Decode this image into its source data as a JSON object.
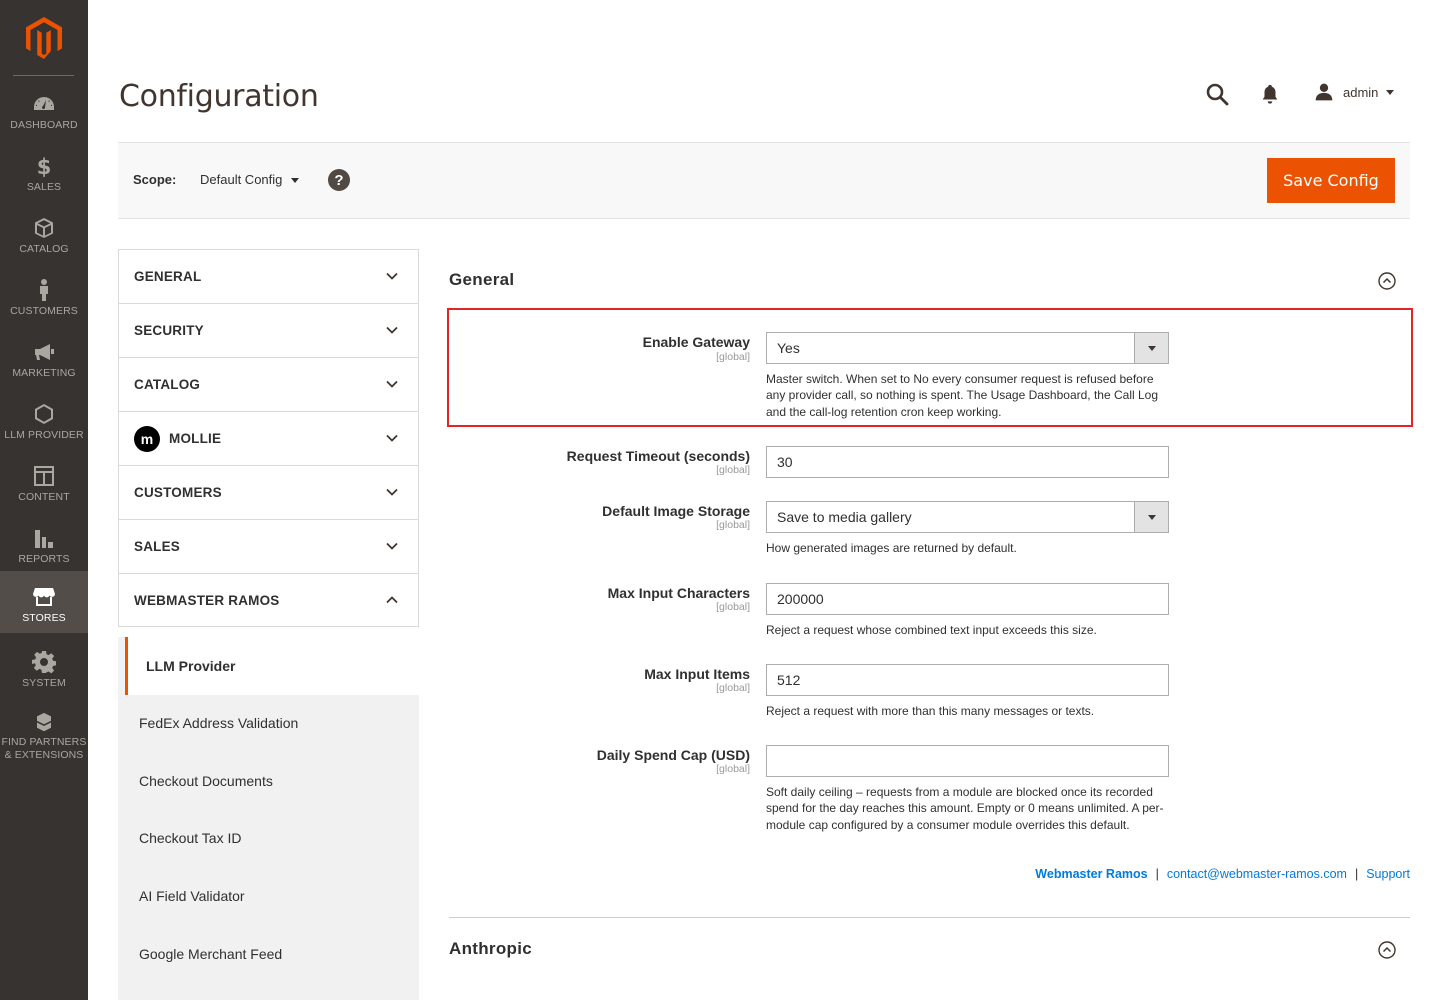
{
  "nav": {
    "items": [
      {
        "label": "DASHBOARD",
        "icon": "dashboard-icon"
      },
      {
        "label": "SALES",
        "icon": "dollar-icon"
      },
      {
        "label": "CATALOG",
        "icon": "box-icon"
      },
      {
        "label": "CUSTOMERS",
        "icon": "person-icon"
      },
      {
        "label": "MARKETING",
        "icon": "megaphone-icon"
      },
      {
        "label": "LLM PROVIDER",
        "icon": "hexagon-icon"
      },
      {
        "label": "CONTENT",
        "icon": "layout-icon"
      },
      {
        "label": "REPORTS",
        "icon": "bar-chart-icon"
      },
      {
        "label": "STORES",
        "icon": "store-icon"
      },
      {
        "label": "SYSTEM",
        "icon": "gear-icon"
      },
      {
        "label": "FIND PARTNERS & EXTENSIONS",
        "icon": "extensions-icon"
      }
    ],
    "active": "STORES"
  },
  "header": {
    "title": "Configuration",
    "user": "admin"
  },
  "scope": {
    "label": "Scope:",
    "value": "Default Config",
    "help": "?",
    "save_label": "Save Config"
  },
  "tabs": [
    {
      "label": "GENERAL"
    },
    {
      "label": "SECURITY"
    },
    {
      "label": "CATALOG"
    },
    {
      "label": "MOLLIE",
      "logo": "m"
    },
    {
      "label": "CUSTOMERS"
    },
    {
      "label": "SALES"
    },
    {
      "label": "WEBMASTER RAMOS"
    }
  ],
  "subtabs": [
    {
      "label": "LLM Provider",
      "active": true
    },
    {
      "label": "FedEx Address Validation"
    },
    {
      "label": "Checkout Documents"
    },
    {
      "label": "Checkout Tax ID"
    },
    {
      "label": "AI Field Validator"
    },
    {
      "label": "Google Merchant Feed"
    }
  ],
  "sections": {
    "general": "General",
    "anthropic": "Anthropic"
  },
  "fields": [
    {
      "label": "Enable Gateway",
      "scope": "[global]",
      "value": "Yes",
      "type": "select",
      "note": "Master switch. When set to No every consumer request is refused before any provider call, so nothing is spent. The Usage Dashboard, the Call Log and the call-log retention cron keep working."
    },
    {
      "label": "Request Timeout (seconds)",
      "scope": "[global]",
      "value": "30",
      "type": "text",
      "note": ""
    },
    {
      "label": "Default Image Storage",
      "scope": "[global]",
      "value": "Save to media gallery",
      "type": "select",
      "note": "How generated images are returned by default."
    },
    {
      "label": "Max Input Characters",
      "scope": "[global]",
      "value": "200000",
      "type": "text",
      "note": "Reject a request whose combined text input exceeds this size."
    },
    {
      "label": "Max Input Items",
      "scope": "[global]",
      "value": "512",
      "type": "text",
      "note": "Reject a request with more than this many messages or texts."
    },
    {
      "label": "Daily Spend Cap (USD)",
      "scope": "[global]",
      "value": "",
      "type": "text",
      "note": "Soft daily ceiling – requests from a module are blocked once its recorded spend for the day reaches this amount. Empty or 0 means unlimited. A per-module cap configured by a consumer module overrides this default."
    }
  ],
  "footer": {
    "vendor": "Webmaster Ramos",
    "email": "contact@webmaster-ramos.com",
    "support": "Support",
    "separator": "|"
  },
  "colors": {
    "nav_bg": "#373330",
    "accent": "#eb5202",
    "link": "#007bdb",
    "highlight": "#e22626"
  }
}
